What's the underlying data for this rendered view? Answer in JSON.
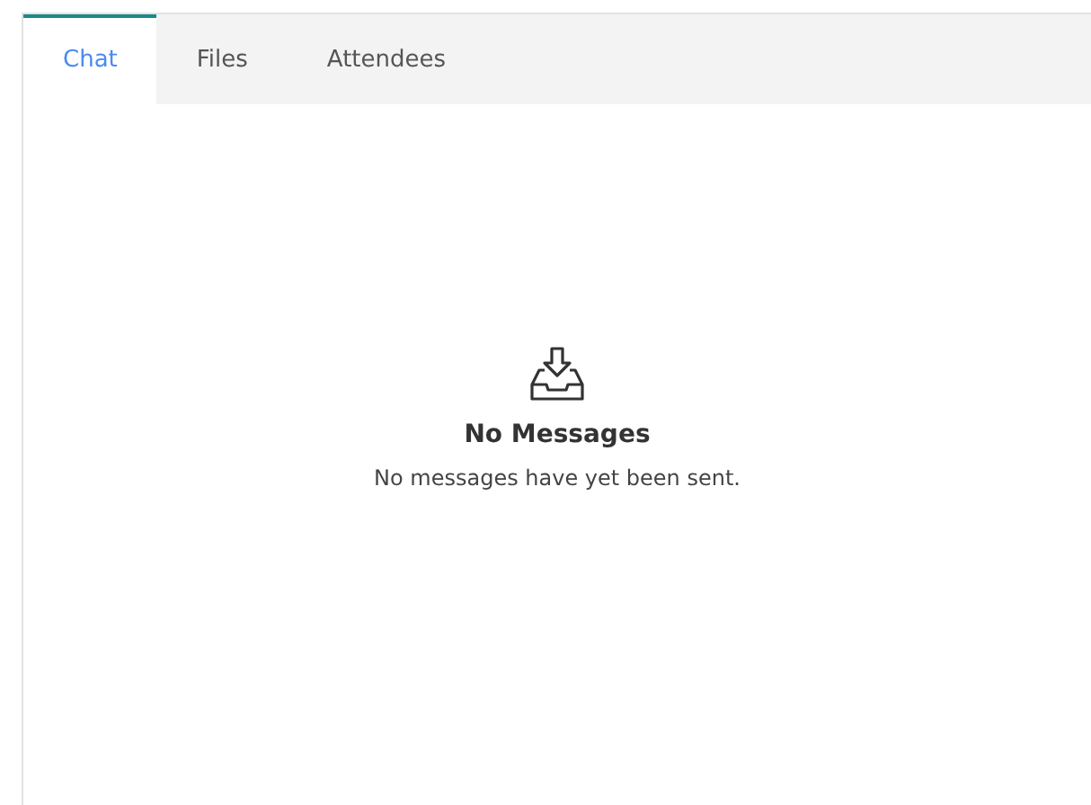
{
  "tabs": [
    {
      "label": "Chat",
      "selected": true
    },
    {
      "label": "Files",
      "selected": false
    },
    {
      "label": "Attendees",
      "selected": false
    }
  ],
  "empty_state": {
    "title": "No Messages",
    "message": "No messages have yet been sent."
  }
}
